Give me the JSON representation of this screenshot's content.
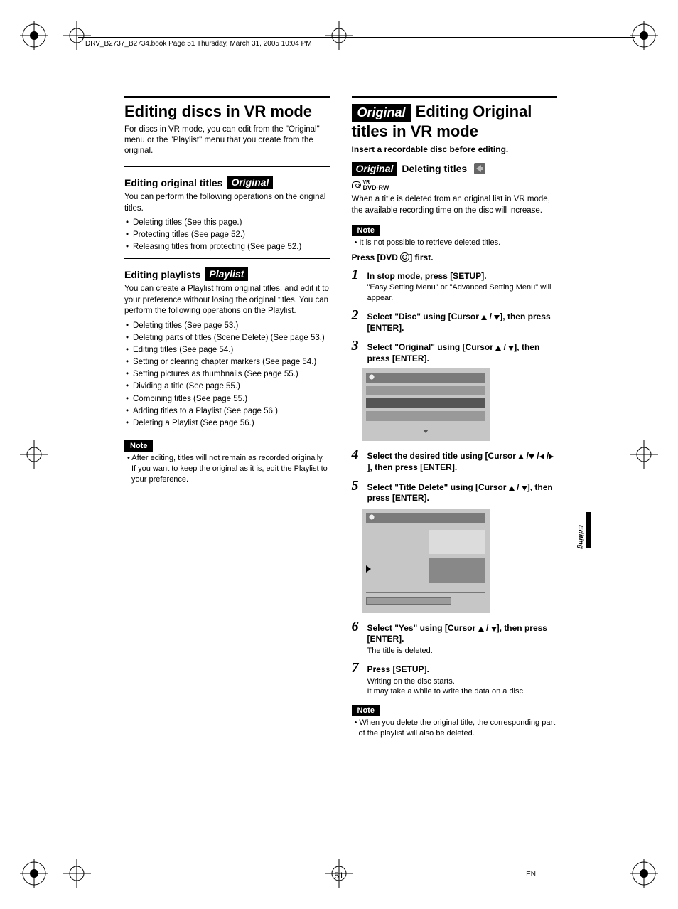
{
  "header": {
    "bookline": "DRV_B2737_B2734.book  Page 51  Thursday, March 31, 2005  10:04 PM"
  },
  "left": {
    "h1": "Editing discs in VR mode",
    "intro": "For discs in VR mode, you can edit from the \"Original\" menu or the \"Playlist\" menu that you create from the original.",
    "sec1_title": "Editing original titles",
    "sec1_badge": "Original",
    "sec1_para": "You can perform the following operations on the original titles.",
    "sec1_bullets": [
      "Deleting titles (See this page.)",
      "Protecting titles (See page 52.)",
      "Releasing titles from protecting (See page 52.)"
    ],
    "sec2_title": "Editing playlists",
    "sec2_badge": "Playlist",
    "sec2_para": "You can create a Playlist from original titles, and edit it to your preference without losing the original titles. You can perform the following operations on the Playlist.",
    "sec2_bullets": [
      "Deleting titles (See page 53.)",
      "Deleting parts of titles (Scene Delete) (See page 53.)",
      "Editing titles (See page 54.)",
      "Setting or clearing chapter markers (See page 54.)",
      "Setting pictures as thumbnails (See page 55.)",
      "Dividing a title (See page 55.)",
      "Combining titles (See page 55.)",
      "Adding titles to a Playlist (See page 56.)",
      "Deleting a Playlist (See page 56.)"
    ],
    "note_label": "Note",
    "note_text": "• After editing, titles will not remain as recorded originally. If you want to keep the original as it is, edit the Playlist to your preference."
  },
  "right": {
    "h1_badge": "Original",
    "h1_text": "Editing Original titles in VR mode",
    "insert_line": "Insert a recordable disc before editing.",
    "del_badge": "Original",
    "del_title": "Deleting titles",
    "rw_vr": "VR",
    "rw_name": "DVD-RW",
    "del_intro": "When a title is deleted from an original list in VR mode, the available recording time on the disc will increase.",
    "note_label": "Note",
    "note1_text": "• It is not possible to retrieve deleted titles.",
    "press_first_pre": "Press [DVD",
    "press_first_post": "] first.",
    "steps": [
      {
        "num": "1",
        "title": "In stop mode, press [SETUP].",
        "desc": "\"Easy Setting Menu\" or \"Advanced Setting Menu\" will appear."
      },
      {
        "num": "2",
        "title_parts": [
          "Select \"Disc\" using [Cursor ",
          "/",
          "], then press [ENTER]."
        ]
      },
      {
        "num": "3",
        "title_parts": [
          "Select \"Original\" using [Cursor ",
          "/",
          "], then press [ENTER]."
        ]
      },
      {
        "num": "4",
        "title_parts": [
          "Select the desired title using [Cursor ",
          "/",
          "/",
          "/",
          "], then press [ENTER]."
        ]
      },
      {
        "num": "5",
        "title_parts": [
          "Select \"Title Delete\" using [Cursor ",
          "/",
          "], then press [ENTER]."
        ]
      },
      {
        "num": "6",
        "title_parts": [
          "Select \"Yes\" using [Cursor ",
          "/",
          "], then press [ENTER]."
        ],
        "desc": "The title is deleted."
      },
      {
        "num": "7",
        "title": "Press [SETUP].",
        "desc": "Writing on the disc starts.\nIt may take a while to write the data on a disc."
      }
    ],
    "note2_text": "• When you delete the original title, the corresponding part of the playlist will also be deleted."
  },
  "side_tab": "Editing",
  "footer": {
    "page": "51",
    "lang": "EN"
  }
}
